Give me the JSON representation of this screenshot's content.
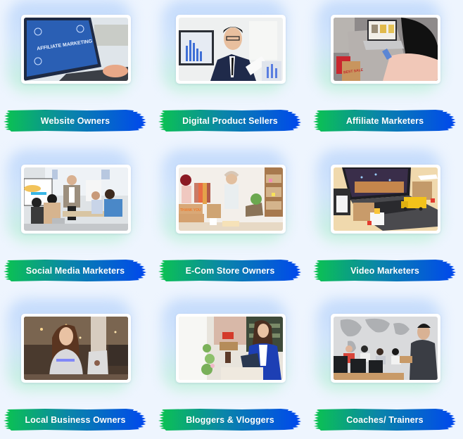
{
  "colors": {
    "background": "#eef5fe",
    "brush_start": "#0bc44f",
    "brush_mid": "#0a86a8",
    "brush_end": "#0047ee",
    "label_text": "#ffffff"
  },
  "audiences": [
    {
      "label": "Website Owners",
      "image": "laptop-affiliate-marketing-photo",
      "image_caption": "AFFILIATE MARKETING"
    },
    {
      "label": "Digital Product Sellers",
      "image": "businessman-with-charts-photo"
    },
    {
      "label": "Affiliate Marketers",
      "image": "woman-shopping-online-photo",
      "image_caption": "BEST SALE"
    },
    {
      "label": "Social Media Marketers",
      "image": "team-meeting-photo"
    },
    {
      "label": "E-Com Store Owners",
      "image": "woman-packing-orders-photo",
      "image_caption": "THANK YOU"
    },
    {
      "label": "Video Marketers",
      "image": "laptop-delivery-truck-photo"
    },
    {
      "label": "Local Business Owners",
      "image": "woman-laptop-cafe-photo"
    },
    {
      "label": "Bloggers & Vloggers",
      "image": "woman-tablet-cafe-photo"
    },
    {
      "label": "Coaches/ Trainers",
      "image": "trainer-with-class-photo"
    }
  ]
}
